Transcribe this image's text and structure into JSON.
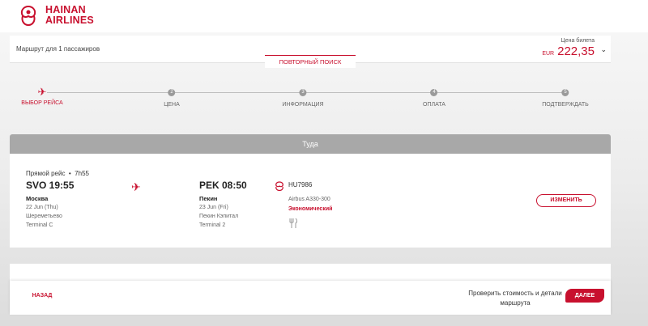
{
  "brand": {
    "name_line1": "HAINAN",
    "name_line2": "AIRLINES"
  },
  "route": {
    "text": "Маршрут для 1 пассажиров"
  },
  "price": {
    "label": "Цена билета",
    "currency": "EUR",
    "value": "222,35"
  },
  "search": {
    "label": "ПОВТОРНЫЙ ПОИСК"
  },
  "steps": [
    {
      "label": "ВЫБОР РЕЙСА",
      "number": ""
    },
    {
      "label": "ЦЕНА",
      "number": "2"
    },
    {
      "label": "ИНФОРМАЦИЯ",
      "number": "3"
    },
    {
      "label": "ОПЛАТА",
      "number": "4"
    },
    {
      "label": "ПОДТВЕРЖДАТЬ",
      "number": "5"
    }
  ],
  "flight": {
    "heading": "Туда",
    "direct_label": "Прямой рейс",
    "duration": "7h55",
    "departure": {
      "time": "SVO 19:55",
      "city": "Москва",
      "date": "22 Jun (Thu)",
      "airport": "Шереметьево",
      "terminal": "Terminal C"
    },
    "arrival": {
      "time": "PEK 08:50",
      "city": "Пекин",
      "date": "23 Jun (Fri)",
      "airport": "Пекин Кэпитал",
      "terminal": "Terminal 2"
    },
    "flight_number": "HU7986",
    "aircraft": "Airbus A330-300",
    "cabin": "Экономический",
    "change_label": "ИЗМЕНИТЬ"
  },
  "footer": {
    "back_label": "НАЗАД",
    "check_text": "Проверить стоимость и детали маршрута",
    "next_label": "ДАЛЕЕ"
  },
  "colors": {
    "accent": "#c8102e",
    "header_grey": "#a8a8a8"
  }
}
